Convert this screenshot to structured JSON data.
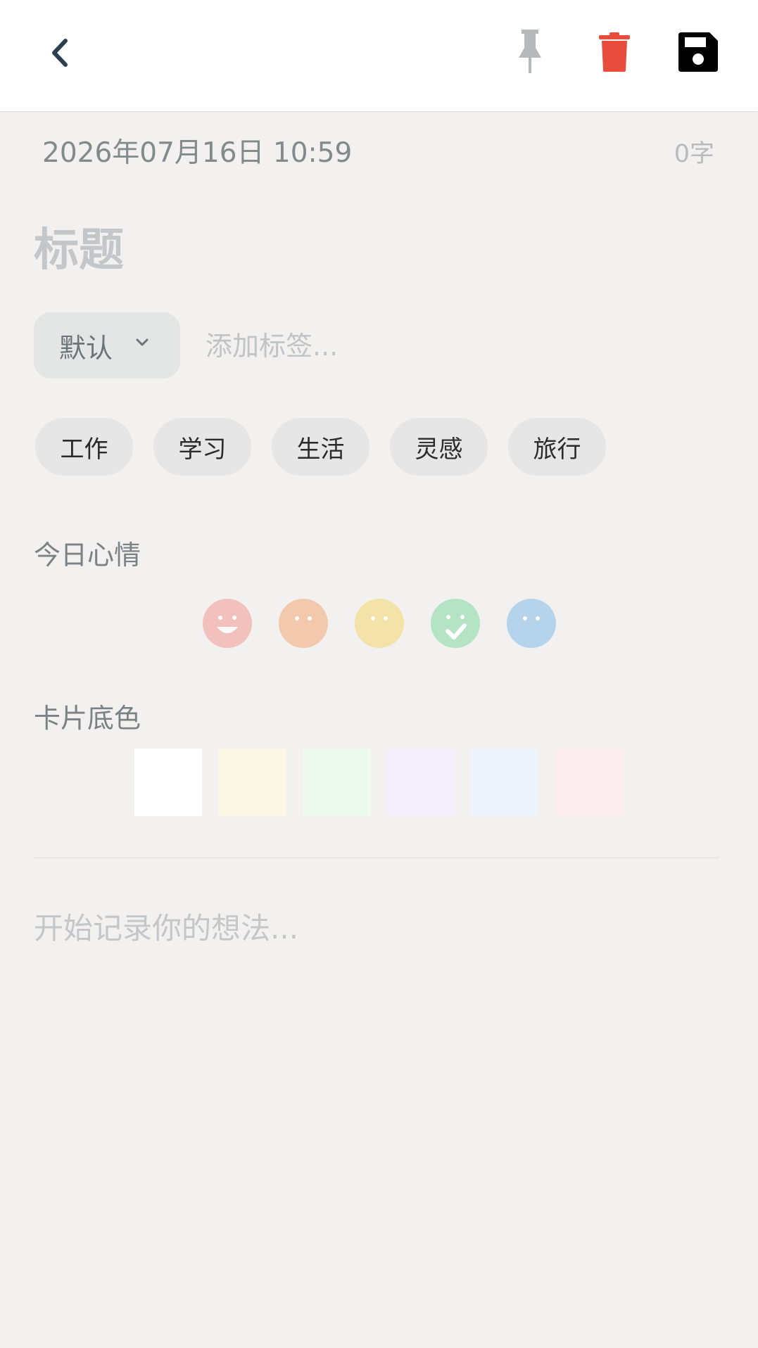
{
  "header": {
    "back_icon": "chevron-left-icon",
    "pin_icon": "pin-icon",
    "delete_icon": "trash-icon",
    "save_icon": "floppy-disk-icon",
    "colors": {
      "pin": "#b5b9bc",
      "delete": "#e74c3c",
      "save": "#000000",
      "back": "#2c3e50"
    }
  },
  "meta": {
    "date": "2026年07月16日 10:59",
    "word_count": "0字"
  },
  "title": {
    "placeholder": "标题",
    "value": ""
  },
  "category": {
    "selected": "默认"
  },
  "tags": {
    "placeholder": "添加标签...",
    "suggestions": [
      "工作",
      "学习",
      "生活",
      "灵感",
      "旅行"
    ]
  },
  "mood": {
    "label": "今日心情",
    "options": [
      {
        "icon": "laughing-face-icon",
        "color": "#f2c0bd"
      },
      {
        "icon": "neutral-face-icon",
        "color": "#f2c9ad"
      },
      {
        "icon": "neutral-face-icon",
        "color": "#f3e3a8"
      },
      {
        "icon": "check-face-icon",
        "color": "#b4e4c4"
      },
      {
        "icon": "neutral-face-icon",
        "color": "#b5d3ea"
      }
    ]
  },
  "card_color": {
    "label": "卡片底色",
    "options": [
      "#ffffff",
      "#fdf7e6",
      "#edfaed",
      "#f3f0fb",
      "#eef3fc",
      "#fdedf1"
    ]
  },
  "content": {
    "placeholder": "开始记录你的想法...",
    "value": ""
  }
}
